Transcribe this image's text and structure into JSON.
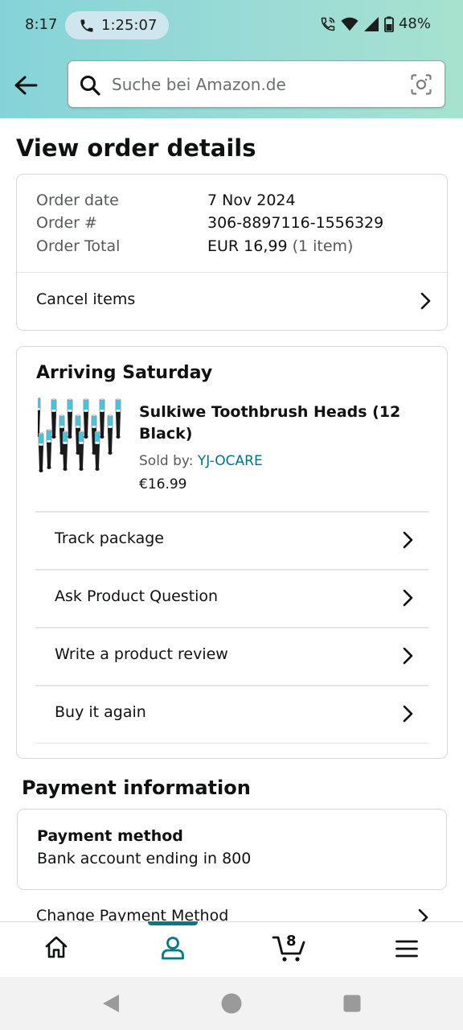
{
  "status_bar": {
    "time": "8:17",
    "call_timer": "1:25:07",
    "battery": "48%"
  },
  "header": {
    "search_placeholder": "Suche bei Amazon.de"
  },
  "page": {
    "title": "View order details"
  },
  "order_summary": {
    "order_date_label": "Order date",
    "order_date_value": "7 Nov 2024",
    "order_number_label": "Order #",
    "order_number_value": "306-8897116-1556329",
    "order_total_label": "Order Total",
    "order_total_value": "EUR 16,99",
    "order_total_items": "(1 item)",
    "cancel_items_label": "Cancel items"
  },
  "shipment": {
    "status": "Arriving Saturday",
    "product_title": "Sulkiwe Toothbrush Heads (12 Black)",
    "sold_by_label": "Sold by:",
    "seller": "YJ-OCARE",
    "price": "€16.99",
    "actions": [
      {
        "label": "Track package"
      },
      {
        "label": "Ask Product Question"
      },
      {
        "label": "Write a product review"
      },
      {
        "label": "Buy it again"
      }
    ]
  },
  "payment": {
    "section_title": "Payment information",
    "method_label": "Payment method",
    "method_value": "Bank account ending in 800",
    "change_label": "Change Payment Method"
  },
  "bottom_nav": {
    "active_tab": "account",
    "cart_count": "8"
  },
  "colors": {
    "accent": "#007185",
    "nav_accent": "#007a87",
    "header_gradient_start": "#85d3d8",
    "header_gradient_end": "#a7e2cf"
  },
  "icons": [
    "back-arrow-icon",
    "search-icon",
    "camera-scan-icon",
    "chevron-right-icon",
    "home-icon",
    "account-icon",
    "cart-icon",
    "menu-icon",
    "phone-icon",
    "wifi-icon",
    "signal-icon",
    "battery-icon"
  ]
}
